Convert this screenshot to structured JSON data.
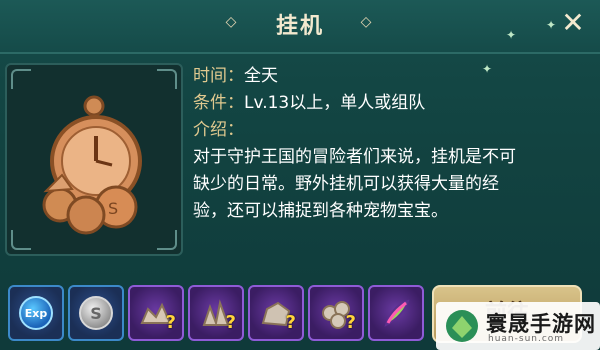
{
  "dialog": {
    "title": "挂机",
    "close_symbol": "✕"
  },
  "info": {
    "time_label": "时间：",
    "time_value": "全天",
    "condition_label": "条件：",
    "condition_value": "Lv.13以上，单人或组队",
    "intro_label": "介绍：",
    "description": "对于守护王国的冒险者们来说，挂机是不可\n缺少的日常。野外挂机可以获得大量的经\n验，还可以捕捉到各种宠物宝宝。"
  },
  "rewards": [
    {
      "name": "exp",
      "text": "Exp",
      "rarity": "blue"
    },
    {
      "name": "silver-coin",
      "text": "S",
      "rarity": "blue"
    },
    {
      "name": "mystery-box-1",
      "rarity": "purple",
      "mark": "?"
    },
    {
      "name": "mystery-box-2",
      "rarity": "purple",
      "mark": "?"
    },
    {
      "name": "mystery-box-3",
      "rarity": "purple",
      "mark": "?"
    },
    {
      "name": "mystery-box-4",
      "rarity": "purple",
      "mark": "?"
    },
    {
      "name": "feather",
      "rarity": "purple"
    }
  ],
  "go_button": {
    "label": "前往"
  },
  "watermark": {
    "text": "寰晟手游网",
    "url": "huan-sun.com"
  },
  "colors": {
    "panel": "#154b49",
    "label": "#e0c98f",
    "button": "#d8c38a",
    "blue_slot_border": "#3c89c9",
    "purple_slot_border": "#8f5bd6"
  }
}
